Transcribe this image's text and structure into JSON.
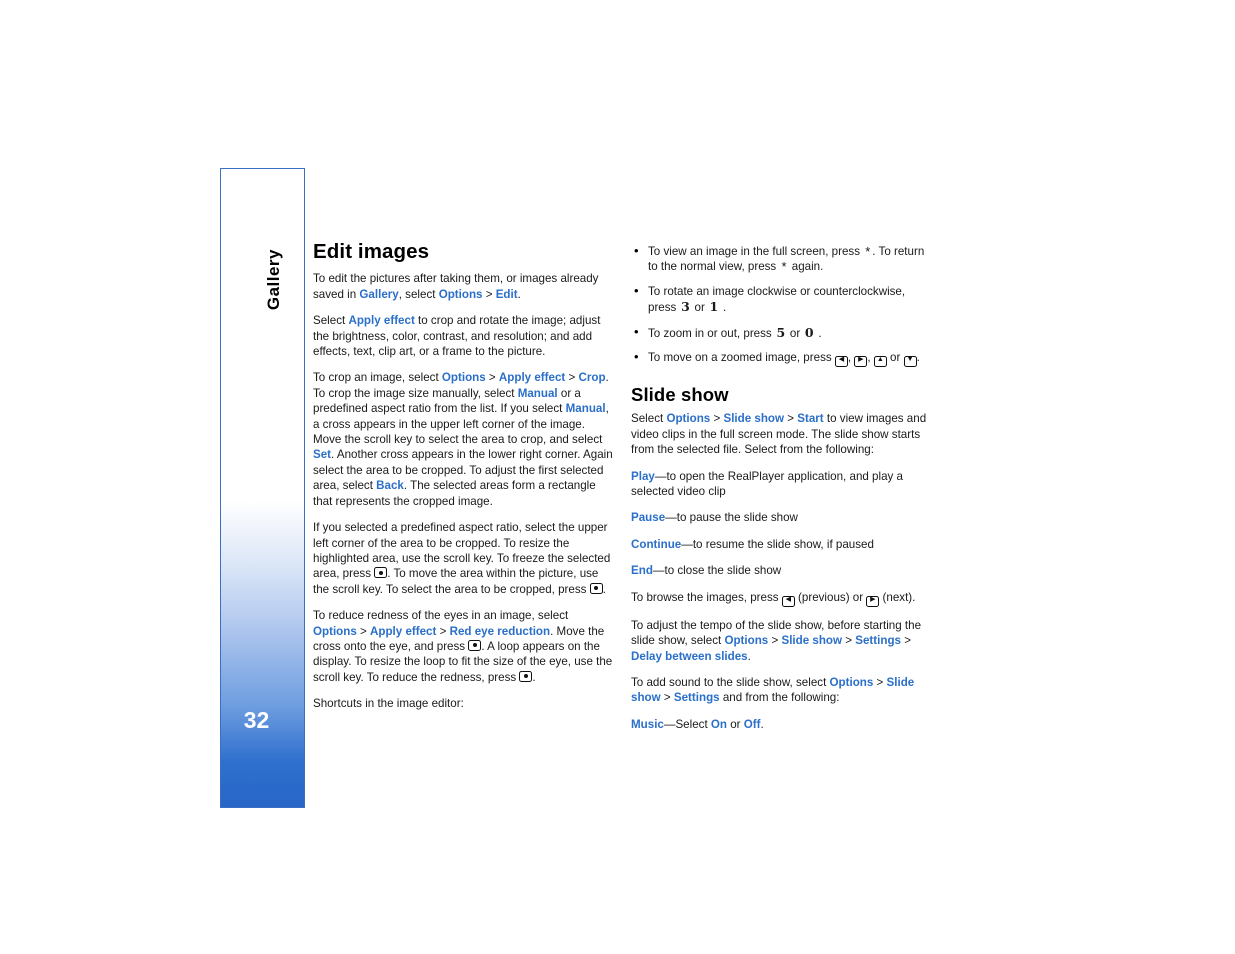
{
  "sidebar": {
    "chapter_label": "Gallery",
    "page_number": "32"
  },
  "left_column": {
    "heading": "Edit images",
    "p1_a": "To edit the pictures after taking them, or images already saved in ",
    "p1_gallery": "Gallery",
    "p1_b": ", select ",
    "p1_options": "Options",
    "p1_gt1": " > ",
    "p1_edit": "Edit",
    "p1_c": ".",
    "p2_a": "Select ",
    "p2_apply": "Apply effect",
    "p2_b": " to crop and rotate the image; adjust the brightness, color, contrast, and resolution; and add effects, text, clip art, or a frame to the picture.",
    "p3_a": "To crop an image, select ",
    "p3_options": "Options",
    "p3_gt1": " > ",
    "p3_apply": "Apply effect",
    "p3_gt2": " > ",
    "p3_crop": "Crop",
    "p3_b": ". To crop the image size manually, select ",
    "p3_manual1": "Manual",
    "p3_c": " or a predefined aspect ratio from the list. If you select ",
    "p3_manual2": "Manual",
    "p3_d": ", a cross appears in the upper left corner of the image. Move the scroll key to select the area to crop, and select ",
    "p3_set": "Set",
    "p3_e": ". Another cross appears in the lower right corner. Again select the area to be cropped. To adjust the first selected area, select ",
    "p3_back": "Back",
    "p3_f": ". The selected areas form a rectangle that represents the cropped image.",
    "p4_a": "If you selected a predefined aspect ratio, select the upper left corner of the area to be cropped. To resize the highlighted area, use the scroll key. To freeze the selected area, press ",
    "p4_b": ". To move the area within the picture, use the scroll key. To select the area to be cropped, press ",
    "p4_c": ".",
    "p5_a": "To reduce redness of the eyes in an image, select ",
    "p5_options": "Options",
    "p5_gt1": " > ",
    "p5_apply": "Apply effect",
    "p5_gt2": " > ",
    "p5_red": "Red eye reduction",
    "p5_b": ". Move the cross onto the eye, and press ",
    "p5_c": ". A loop appears on the display. To resize the loop to fit the size of the eye, use the scroll key. To reduce the redness, press ",
    "p5_d": ".",
    "p6": "Shortcuts in the image editor:"
  },
  "right_column": {
    "bullets": [
      {
        "a": "To view an image in the full screen, press ",
        "key1": "*",
        "b": ". To return to the normal view, press ",
        "key2": "*",
        "c": " again."
      },
      {
        "a": "To rotate an image clockwise or counterclockwise, press ",
        "key1": "3",
        "b": " or ",
        "key2": "1",
        "c": " ."
      },
      {
        "a": "To zoom in or out, press ",
        "key1": "5",
        "b": " or ",
        "key2": "0",
        "c": " ."
      },
      {
        "a": "To move on a zoomed image, press ",
        "b": ", ",
        "c": ", ",
        "d": " or ",
        "e": "."
      }
    ],
    "heading": "Slide show",
    "p1_a": "Select ",
    "p1_options": "Options",
    "p1_gt1": " > ",
    "p1_slideshow": "Slide show",
    "p1_gt2": " > ",
    "p1_start": "Start",
    "p1_b": " to view images and video clips in the full screen mode. The slide show starts from the selected file. Select from the following:",
    "play_kw": "Play",
    "play_txt": "—to open the RealPlayer application, and play a selected video clip",
    "pause_kw": "Pause",
    "pause_txt": "—to pause the slide show",
    "continue_kw": "Continue",
    "continue_txt": "—to resume the slide show, if paused",
    "end_kw": "End",
    "end_txt": "—to close the slide show",
    "p_browse_a": "To browse the images, press ",
    "p_browse_b": " (previous) or ",
    "p_browse_c": " (next).",
    "p_tempo_a": "To adjust the tempo of the slide show, before starting the slide show, select ",
    "p_tempo_options": "Options",
    "p_tempo_gt1": " > ",
    "p_tempo_slideshow": "Slide show",
    "p_tempo_gt2": " > ",
    "p_tempo_settings": "Settings",
    "p_tempo_gt3": " > ",
    "p_tempo_delay": "Delay between slides",
    "p_tempo_b": ".",
    "p_sound_a": "To add sound to the slide show, select ",
    "p_sound_options": "Options",
    "p_sound_gt1": " > ",
    "p_sound_slideshow": "Slide show",
    "p_sound_gt2": " > ",
    "p_sound_settings": "Settings",
    "p_sound_b": " and from the following:",
    "music_kw": "Music",
    "music_dash": "—Select ",
    "music_on": "On",
    "music_or": " or ",
    "music_off": "Off",
    "music_end": "."
  }
}
